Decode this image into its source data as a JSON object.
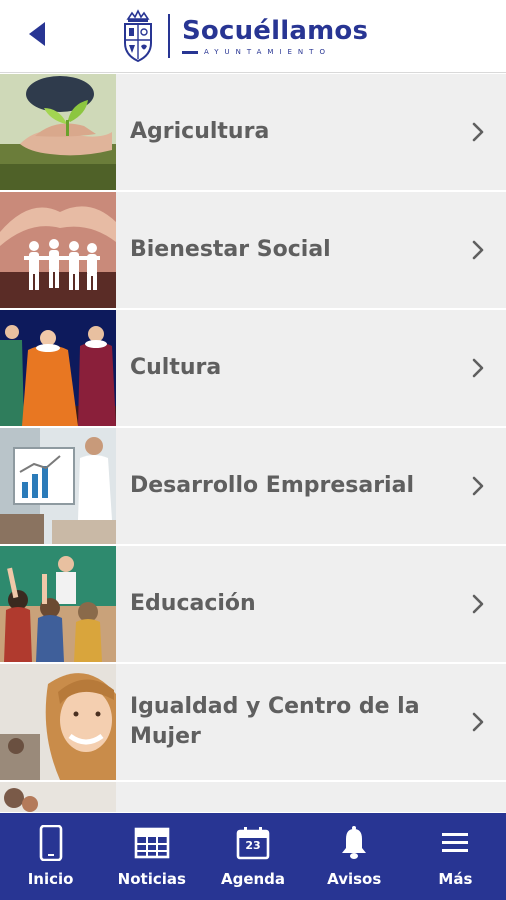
{
  "header": {
    "back_icon": "chevron-left-icon",
    "logo": {
      "title": "Socuéllamos",
      "subtitle": "AYUNTAMIENTO",
      "brand_color": "#283593"
    }
  },
  "list": {
    "items": [
      {
        "label": "Agricultura",
        "image": "seedling-photo",
        "icon": "chevron-right-icon"
      },
      {
        "label": "Bienestar Social",
        "image": "hands-paper-people-photo",
        "icon": "chevron-right-icon"
      },
      {
        "label": "Cultura",
        "image": "theatre-costumes-photo",
        "icon": "chevron-right-icon"
      },
      {
        "label": "Desarrollo Empresarial",
        "image": "business-presentation-photo",
        "icon": "chevron-right-icon"
      },
      {
        "label": "Educación",
        "image": "classroom-photo",
        "icon": "chevron-right-icon"
      },
      {
        "label": "Igualdad y Centro de la Mujer",
        "image": "smiling-woman-photo",
        "icon": "chevron-right-icon"
      }
    ],
    "item_background": "#efefef",
    "text_color": "#5f5f5f"
  },
  "bottom_nav": {
    "background": "#283593",
    "items": [
      {
        "label": "Inicio",
        "icon": "phone-icon"
      },
      {
        "label": "Noticias",
        "icon": "newspaper-icon"
      },
      {
        "label": "Agenda",
        "icon": "calendar-icon",
        "badge": "23"
      },
      {
        "label": "Avisos",
        "icon": "bell-icon"
      },
      {
        "label": "Más",
        "icon": "menu-icon"
      }
    ]
  }
}
